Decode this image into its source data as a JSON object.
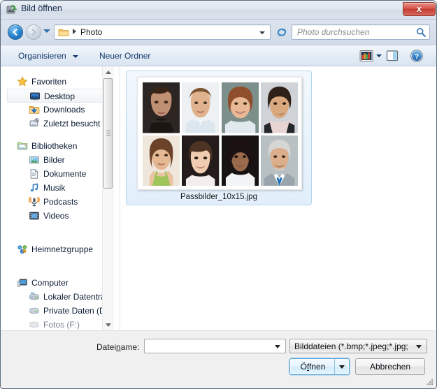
{
  "window": {
    "title": "Bild öffnen",
    "app_icon": "image-app-icon",
    "close_label": "x"
  },
  "navbar": {
    "back_icon": "back-arrow-icon",
    "forward_icon": "forward-arrow-icon",
    "history_icon": "history-dropdown-icon",
    "address_folder_icon": "folder-icon",
    "breadcrumb": "Photo",
    "address_dropdown_icon": "chevron-down-icon",
    "refresh_icon": "refresh-icon",
    "search_placeholder": "Photo durchsuchen",
    "search_icon": "search-icon"
  },
  "toolbar": {
    "organize_label": "Organisieren",
    "new_folder_label": "Neuer Ordner",
    "views_icon": "view-options-icon",
    "views_caret_icon": "chevron-down-icon",
    "preview_icon": "preview-pane-icon",
    "help_icon": "help-icon"
  },
  "navpane": {
    "groups": [
      {
        "label": "Favoriten",
        "icon": "star-icon",
        "items": [
          {
            "label": "Desktop",
            "icon": "desktop-monitor-icon",
            "selected": true
          },
          {
            "label": "Downloads",
            "icon": "downloads-folder-icon",
            "selected": false
          },
          {
            "label": "Zuletzt besucht",
            "icon": "recent-places-icon",
            "selected": false
          }
        ]
      },
      {
        "label": "Bibliotheken",
        "icon": "libraries-icon",
        "items": [
          {
            "label": "Bilder",
            "icon": "pictures-icon",
            "selected": false
          },
          {
            "label": "Dokumente",
            "icon": "documents-icon",
            "selected": false
          },
          {
            "label": "Musik",
            "icon": "music-note-icon",
            "selected": false
          },
          {
            "label": "Podcasts",
            "icon": "podcast-microphone-icon",
            "selected": false
          },
          {
            "label": "Videos",
            "icon": "video-film-icon",
            "selected": false
          }
        ]
      },
      {
        "label": "Heimnetzgruppe",
        "icon": "homegroup-icon",
        "items": []
      },
      {
        "label": "Computer",
        "icon": "computer-icon",
        "items": [
          {
            "label": "Lokaler Datenträ",
            "icon": "local-disk-icon",
            "selected": false
          },
          {
            "label": "Private Daten (D",
            "icon": "drive-icon",
            "selected": false
          },
          {
            "label": "Fotos (F:)",
            "icon": "drive-icon",
            "selected": false
          }
        ]
      }
    ],
    "scrollbar": {
      "up_icon": "scroll-up-icon",
      "down_icon": "scroll-down-icon"
    }
  },
  "files": {
    "items": [
      {
        "name": "Passbilder_10x15.jpg",
        "selected": true,
        "thumbnail_type": "photo-collage",
        "thumbnail_cells": [
          {
            "id": "portrait-1",
            "bg": "#2b2523",
            "skin": "#c09073",
            "hair": "#3a2418"
          },
          {
            "id": "portrait-2",
            "bg": "#eef1f4",
            "skin": "#e0b38e",
            "hair": "#7c5533"
          },
          {
            "id": "portrait-3",
            "bg": "#7d8f8b",
            "skin": "#e8b894",
            "hair": "#8f4f2c"
          },
          {
            "id": "portrait-4",
            "bg": "#cfd2d6",
            "skin": "#d9a87f",
            "hair": "#2f2119"
          },
          {
            "id": "portrait-5",
            "bg": "#efe6dc",
            "skin": "#e3b892",
            "hair": "#6b4329"
          },
          {
            "id": "portrait-6",
            "bg": "#231c1a",
            "skin": "#f0cdb0",
            "hair": "#4d3324"
          },
          {
            "id": "portrait-7",
            "bg": "#171312",
            "skin": "#9a6a4c",
            "hair": "#1a1110"
          },
          {
            "id": "portrait-8",
            "bg": "#b9c0c4",
            "skin": "#dcae8b",
            "hair": "#d6d6d4"
          }
        ]
      }
    ]
  },
  "footer": {
    "filename_label_pre": "Datei",
    "filename_label_accel": "n",
    "filename_label_post": "ame:",
    "filename_value": "",
    "filename_caret_icon": "chevron-down-icon",
    "filter_value": "Bilddateien (*.bmp;*.jpeg;*.jpg;",
    "filter_caret_icon": "chevron-down-icon",
    "open_label_pre": "Ö",
    "open_label_accel": "f",
    "open_label_post": "fnen",
    "open_split_icon": "chevron-down-icon",
    "cancel_label": "Abbrechen",
    "resize_grip_icon": "resize-grip-icon"
  },
  "colors": {
    "accent": "#2c87d0",
    "selection": "#e2effb",
    "selection_border": "#b5d5ef",
    "title_text": "#15294a",
    "toolbar_text": "#13386b",
    "close_red": "#c23c31"
  }
}
